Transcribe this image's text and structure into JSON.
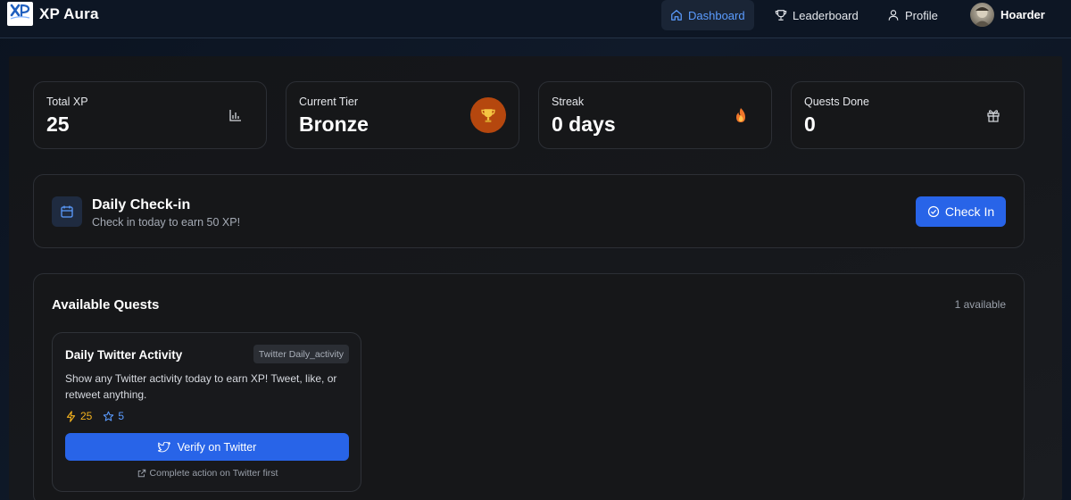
{
  "header": {
    "app_title": "XP Aura",
    "logo_text": "XP AURA",
    "nav": [
      {
        "label": "Dashboard",
        "icon": "home-icon",
        "active": true
      },
      {
        "label": "Leaderboard",
        "icon": "trophy-icon",
        "active": false
      },
      {
        "label": "Profile",
        "icon": "user-icon",
        "active": false
      }
    ],
    "username": "Hoarder",
    "accent_color": "#5b9cff"
  },
  "stats": [
    {
      "label": "Total XP",
      "value": "25",
      "icon": "bar-chart-icon"
    },
    {
      "label": "Current Tier",
      "value": "Bronze",
      "icon": "trophy-icon",
      "icon_bg": "#b5470e"
    },
    {
      "label": "Streak",
      "value": "0 days",
      "icon": "fire-icon"
    },
    {
      "label": "Quests Done",
      "value": "0",
      "icon": "gift-icon"
    }
  ],
  "checkin": {
    "title": "Daily Check-in",
    "subtitle": "Check in today to earn 50 XP!",
    "button_label": "Check In",
    "button_color": "#2864e8"
  },
  "quests": {
    "title": "Available Quests",
    "count_label": "1 available",
    "items": [
      {
        "title": "Daily Twitter Activity",
        "tag": "Twitter Daily_activity",
        "description": "Show any Twitter activity today to earn XP! Tweet, like, or retweet anything.",
        "xp": "25",
        "points": "5",
        "button_label": "Verify on Twitter",
        "note": "Complete action on Twitter first"
      }
    ]
  }
}
